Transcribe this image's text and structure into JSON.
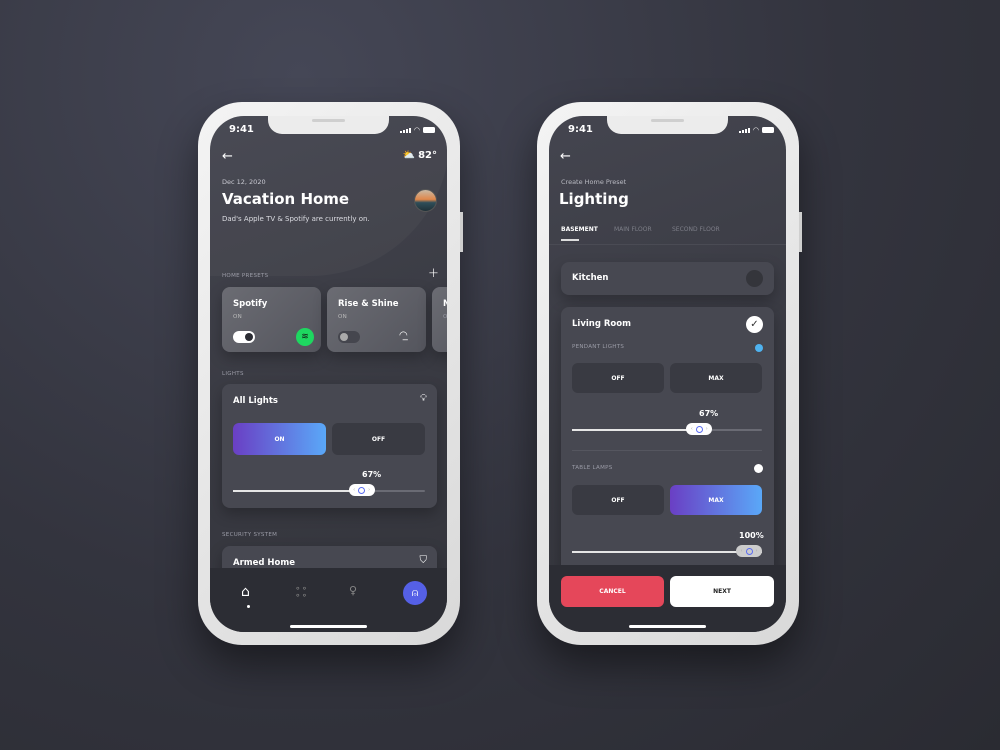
{
  "status": {
    "time": "9:41"
  },
  "home": {
    "weather": {
      "icon": "partly-cloudy-icon",
      "temp": "82°"
    },
    "date": "Dec 12, 2020",
    "title": "Vacation Home",
    "subtitle": "Dad's Apple TV & Spotify are currently on.",
    "presets_label": "HOME PRESETS",
    "presets": [
      {
        "name": "Spotify",
        "state": "ON",
        "toggle_on": true,
        "icon": "spotify-icon"
      },
      {
        "name": "Rise & Shine",
        "state": "ON",
        "toggle_on": false,
        "icon": "sunrise-icon"
      },
      {
        "name": "N",
        "state": "O"
      }
    ],
    "lights_label": "LIGHTS",
    "all_lights": {
      "title": "All Lights",
      "on": "ON",
      "off": "OFF",
      "selected": "ON",
      "level": "67%",
      "level_value": 67
    },
    "security_label": "SECURITY SYSTEM",
    "security": {
      "title": "Armed Home"
    },
    "nav": [
      "home",
      "apps",
      "lights",
      "profile"
    ]
  },
  "lighting": {
    "subtitle": "Create Home Preset",
    "title": "Lighting",
    "tabs": [
      "BASEMENT",
      "MAIN FLOOR",
      "SECOND FLOOR"
    ],
    "active_tab": "BASEMENT",
    "kitchen": "Kitchen",
    "living_room": "Living Room",
    "pendant": {
      "label": "PENDANT LIGHTS",
      "off": "OFF",
      "max": "MAX",
      "level": "67%",
      "level_value": 67,
      "dot_color": "#4fb3f0"
    },
    "table": {
      "label": "TABLE LAMPS",
      "off": "OFF",
      "max": "MAX",
      "selected": "MAX",
      "level": "100%",
      "level_value": 100
    },
    "cancel": "CANCEL",
    "next": "NEXT"
  },
  "colors": {
    "accent_start": "#6a3fc4",
    "accent_end": "#5aa8f8",
    "cancel": "#e5475a",
    "spotify": "#1ed760"
  }
}
